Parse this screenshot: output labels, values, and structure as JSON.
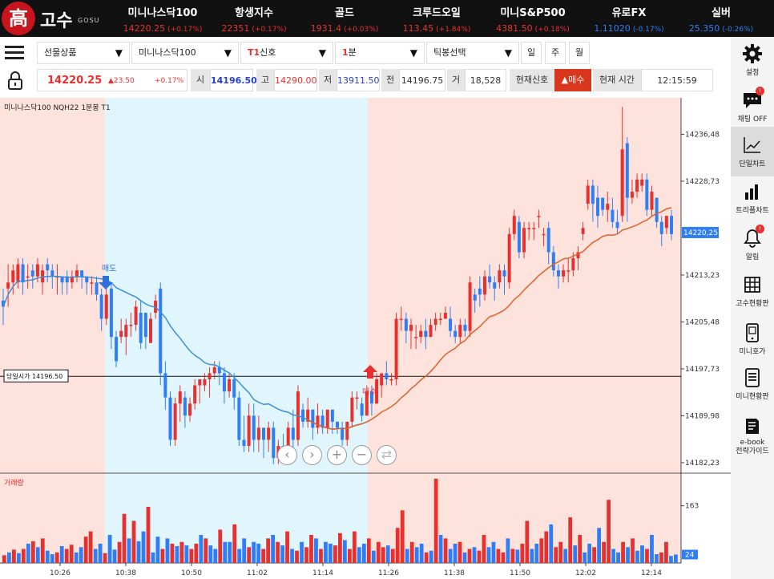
{
  "brand": {
    "logo_char": "高",
    "name": "고수",
    "sub": "GOSU"
  },
  "tickers": [
    {
      "name": "미니나스닥100",
      "value": "14220.25",
      "change": "(+0.17%)",
      "dir": "up"
    },
    {
      "name": "항생지수",
      "value": "22351",
      "change": "(+0.17%)",
      "dir": "up"
    },
    {
      "name": "골드",
      "value": "1931.4",
      "change": "(+0.03%)",
      "dir": "up"
    },
    {
      "name": "크루드오일",
      "value": "113.45",
      "change": "(+1.84%)",
      "dir": "up"
    },
    {
      "name": "미니S&P500",
      "value": "4381.50",
      "change": "(+0.18%)",
      "dir": "up"
    },
    {
      "name": "유로FX",
      "value": "1.11020",
      "change": "(-0.17%)",
      "dir": "down"
    },
    {
      "name": "실버",
      "value": "25.350",
      "change": "(-0.26%)",
      "dir": "down"
    }
  ],
  "toolbar": {
    "product_type": "선물상품",
    "product": "미니나스닥100",
    "signal_prefix": "T1",
    "signal": "신호",
    "interval_num": "1",
    "interval_unit": "분",
    "tick": "틱봉선택",
    "periods": [
      "일",
      "주",
      "월"
    ]
  },
  "quote": {
    "price": "14220.25",
    "change": "▲23.50",
    "pct": "+0.17%",
    "open_label": "시",
    "open": "14196.50",
    "high_label": "고",
    "high": "14290.00",
    "low_label": "저",
    "low": "13911.50",
    "prev_label": "전",
    "prev": "14196.75",
    "vol_label": "거",
    "volume": "18,528",
    "signal_label": "현재신호",
    "signal_value": "▲매수",
    "time_label": "현재 시간",
    "time": "12:15:59"
  },
  "chart_title": "미니나스닥100  NQH22  1분봉  T1",
  "volume_title": "거래량",
  "open_price_label": "당일시가 14196.50",
  "sell_label": "매도",
  "buy_label": "매수",
  "colors": {
    "up": "#e8312f",
    "down": "#2f7ef7",
    "ma_blue": "#3a8fd8",
    "ma_red": "#e0602a",
    "bg_pink": "#fde3dc",
    "bg_cyan": "#e1f5fd"
  },
  "sidebar": [
    {
      "icon": "gear-icon",
      "label": "설정"
    },
    {
      "icon": "chat-icon",
      "label": "채팅 OFF",
      "badge": "!"
    },
    {
      "icon": "line-chart-icon",
      "label": "단일차트",
      "active": true
    },
    {
      "icon": "bar-chart-icon",
      "label": "트리플차트"
    },
    {
      "icon": "bell-icon",
      "label": "알림",
      "badge": "!"
    },
    {
      "icon": "grid-icon",
      "label": "고수현황판"
    },
    {
      "icon": "phone-icon",
      "label": "미니호가"
    },
    {
      "icon": "list-icon",
      "label": "미니현황판"
    },
    {
      "icon": "book-icon",
      "label": "e-book\n전략가이드"
    }
  ],
  "chart_data": {
    "type": "candlestick",
    "y_ticks": [
      14236.48,
      14228.73,
      14213.23,
      14205.48,
      14197.73,
      14189.98,
      14182.23
    ],
    "ylim": [
      14180.5,
      14242.5
    ],
    "current_price": "14220.25",
    "open_line": 14196.5,
    "x_ticks": [
      "10:26",
      "10:38",
      "10:50",
      "11:02",
      "11:14",
      "11:26",
      "11:38",
      "11:50",
      "12:02",
      "12:14"
    ],
    "volume_ticks": [
      "163",
      "24"
    ],
    "volume_max": 240,
    "candles": [
      [
        14209,
        14208,
        14205,
        14211
      ],
      [
        14211,
        14212,
        14208,
        14215
      ],
      [
        14212,
        14214,
        14210,
        14215
      ],
      [
        14212,
        14215,
        14211,
        14216
      ],
      [
        14215,
        14212,
        14210,
        14216
      ],
      [
        14213,
        14213,
        14211,
        14215
      ],
      [
        14214,
        14213,
        14211,
        14215
      ],
      [
        14213,
        14215,
        14212,
        14216
      ],
      [
        14212,
        14214,
        14210,
        14215
      ],
      [
        14215,
        14214,
        14212,
        14216
      ],
      [
        14214,
        14213,
        14211,
        14215
      ],
      [
        14213,
        14213,
        14210,
        14215
      ],
      [
        14213,
        14212,
        14210,
        14213
      ],
      [
        14213,
        14212,
        14210,
        14214
      ],
      [
        14212,
        14213,
        14211,
        14214
      ],
      [
        14213,
        14214,
        14212,
        14215
      ],
      [
        14214,
        14213,
        14211,
        14214
      ],
      [
        14213,
        14212,
        14210,
        14213
      ],
      [
        14212,
        14212,
        14210,
        14213
      ],
      [
        14212,
        14210,
        14209,
        14213
      ],
      [
        14210,
        14206,
        14204,
        14211
      ],
      [
        14206,
        14210,
        14205,
        14211
      ],
      [
        14211,
        14203,
        14201,
        14212
      ],
      [
        14203,
        14199,
        14198,
        14204
      ],
      [
        14203,
        14204,
        14202,
        14206
      ],
      [
        14203,
        14205,
        14200,
        14206
      ],
      [
        14205,
        14205,
        14203,
        14207
      ],
      [
        14205,
        14208,
        14204,
        14209
      ],
      [
        14207,
        14202,
        14201,
        14209
      ],
      [
        14207,
        14203,
        14201,
        14207
      ],
      [
        14202,
        14206,
        14202,
        14207
      ],
      [
        14207,
        14209,
        14206,
        14210
      ],
      [
        14211,
        14197,
        14195,
        14212
      ],
      [
        14197,
        14193,
        14191,
        14199
      ],
      [
        14193,
        14186,
        14185,
        14194
      ],
      [
        14186,
        14192,
        14185,
        14193
      ],
      [
        14192,
        14194,
        14189,
        14195
      ],
      [
        14193,
        14190,
        14188,
        14194
      ],
      [
        14190,
        14192,
        14189,
        14193
      ],
      [
        14192,
        14195,
        14191,
        14196
      ],
      [
        14195,
        14196,
        14192,
        14196
      ],
      [
        14195,
        14196,
        14194,
        14197
      ],
      [
        14196,
        14197,
        14193,
        14198
      ],
      [
        14197,
        14198,
        14196,
        14199
      ],
      [
        14198,
        14197,
        14195,
        14199
      ],
      [
        14197,
        14194,
        14192,
        14198
      ],
      [
        14194,
        14196,
        14193,
        14197
      ],
      [
        14196,
        14193,
        14191,
        14197
      ],
      [
        14193,
        14186,
        14185,
        14194
      ],
      [
        14186,
        14185,
        14184,
        14190
      ],
      [
        14185,
        14190,
        14184,
        14192
      ],
      [
        14190,
        14186,
        14184,
        14192
      ],
      [
        14186,
        14188,
        14184,
        14190
      ],
      [
        14188,
        14186,
        14183,
        14188
      ],
      [
        14186,
        14188,
        14184,
        14189
      ],
      [
        14188,
        14183,
        14182,
        14189
      ],
      [
        14183,
        14185,
        14182,
        14186
      ],
      [
        14185,
        14184,
        14183,
        14187
      ],
      [
        14184,
        14188,
        14183,
        14189
      ],
      [
        14188,
        14186,
        14183,
        14191
      ],
      [
        14186,
        14194,
        14185,
        14195
      ],
      [
        14191,
        14189,
        14188,
        14192
      ],
      [
        14189,
        14191,
        14188,
        14193
      ],
      [
        14191,
        14188,
        14186,
        14191
      ],
      [
        14188,
        14190,
        14187,
        14192
      ],
      [
        14190,
        14188,
        14187,
        14191
      ],
      [
        14188,
        14191,
        14187,
        14191
      ],
      [
        14191,
        14189,
        14187,
        14191
      ],
      [
        14189,
        14188,
        14187,
        14189
      ],
      [
        14188,
        14186,
        14185,
        14189
      ],
      [
        14186,
        14189,
        14185,
        14189
      ],
      [
        14189,
        14193,
        14188,
        14194
      ],
      [
        14193,
        14193,
        14191,
        14194
      ],
      [
        14192,
        14190,
        14189,
        14193
      ],
      [
        14190,
        14194,
        14190,
        14195
      ],
      [
        14194,
        14192,
        14190,
        14195
      ],
      [
        14192,
        14196,
        14192,
        14197
      ],
      [
        14195,
        14197,
        14193,
        14197
      ],
      [
        14197,
        14196,
        14195,
        14199
      ],
      [
        14196,
        14196,
        14195,
        14197
      ],
      [
        14196,
        14206,
        14195,
        14207
      ],
      [
        14206,
        14206,
        14204,
        14208
      ],
      [
        14206,
        14204,
        14202,
        14207
      ],
      [
        14204,
        14205,
        14201,
        14206
      ],
      [
        14203,
        14203,
        14201,
        14205
      ],
      [
        14203,
        14204,
        14202,
        14205
      ],
      [
        14204,
        14203,
        14201,
        14206
      ],
      [
        14203,
        14205,
        14203,
        14206
      ],
      [
        14205,
        14206,
        14204,
        14207
      ],
      [
        14206,
        14206,
        14205,
        14207
      ],
      [
        14206,
        14207,
        14206,
        14208
      ],
      [
        14206,
        14204,
        14203,
        14208
      ],
      [
        14204,
        14203,
        14202,
        14205
      ],
      [
        14203,
        14205,
        14202,
        14206
      ],
      [
        14205,
        14204,
        14203,
        14206
      ],
      [
        14204,
        14212,
        14203,
        14213
      ],
      [
        14210,
        14209,
        14207,
        14211
      ],
      [
        14211,
        14210,
        14208,
        14213
      ],
      [
        14210,
        14213,
        14209,
        14214
      ],
      [
        14213,
        14212,
        14211,
        14215
      ],
      [
        14212,
        14211,
        14209,
        14213
      ],
      [
        14212,
        14214,
        14211,
        14215
      ],
      [
        14214,
        14213,
        14210,
        14215
      ],
      [
        14212,
        14220,
        14211,
        14221
      ],
      [
        14220,
        14223,
        14219,
        14224
      ],
      [
        14222,
        14217,
        14216,
        14223
      ],
      [
        14217,
        14221,
        14216,
        14222
      ],
      [
        14221,
        14221,
        14219,
        14222
      ],
      [
        14221,
        14221,
        14219,
        14222
      ],
      [
        14223,
        14223,
        14221,
        14224
      ],
      [
        14220,
        14220,
        14218,
        14221
      ],
      [
        14221,
        14217,
        14215,
        14222
      ],
      [
        14217,
        14214,
        14213,
        14218
      ],
      [
        14214,
        14213,
        14211,
        14215
      ],
      [
        14213,
        14214,
        14212,
        14215
      ],
      [
        14214,
        14214,
        14212,
        14216
      ],
      [
        14214,
        14216,
        14213,
        14217
      ],
      [
        14216,
        14217,
        14214,
        14218
      ],
      [
        14220,
        14221,
        14219,
        14222
      ],
      [
        14225,
        14228,
        14224,
        14229
      ],
      [
        14228,
        14225,
        14222,
        14229
      ],
      [
        14226,
        14223,
        14221,
        14228
      ],
      [
        14226,
        14224,
        14223,
        14226
      ],
      [
        14224,
        14225,
        14222,
        14227
      ],
      [
        14224,
        14222,
        14221,
        14226
      ],
      [
        14222,
        14221,
        14220,
        14224
      ],
      [
        14223,
        14234,
        14222,
        14241
      ],
      [
        14235,
        14226,
        14222,
        14236
      ],
      [
        14226,
        14227,
        14225,
        14229
      ],
      [
        14227,
        14229,
        14226,
        14230
      ],
      [
        14228,
        14229,
        14227,
        14230
      ],
      [
        14229,
        14224,
        14223,
        14230
      ],
      [
        14224,
        14227,
        14223,
        14228
      ],
      [
        14226,
        14222,
        14221,
        14226
      ],
      [
        14222,
        14220,
        14218,
        14223
      ],
      [
        14221,
        14223,
        14220,
        14223
      ],
      [
        14223,
        14220,
        14219,
        14224
      ]
    ],
    "volumes": [
      [
        22,
        "u"
      ],
      [
        30,
        "d"
      ],
      [
        38,
        "u"
      ],
      [
        28,
        "d"
      ],
      [
        40,
        "u"
      ],
      [
        55,
        "d"
      ],
      [
        62,
        "u"
      ],
      [
        45,
        "d"
      ],
      [
        70,
        "u"
      ],
      [
        35,
        "d"
      ],
      [
        25,
        "d"
      ],
      [
        30,
        "u"
      ],
      [
        48,
        "d"
      ],
      [
        40,
        "u"
      ],
      [
        52,
        "u"
      ],
      [
        30,
        "d"
      ],
      [
        45,
        "d"
      ],
      [
        75,
        "u"
      ],
      [
        90,
        "u"
      ],
      [
        40,
        "d"
      ],
      [
        55,
        "d"
      ],
      [
        28,
        "u"
      ],
      [
        80,
        "d"
      ],
      [
        38,
        "d"
      ],
      [
        60,
        "u"
      ],
      [
        140,
        "u"
      ],
      [
        70,
        "d"
      ],
      [
        120,
        "u"
      ],
      [
        62,
        "d"
      ],
      [
        90,
        "d"
      ],
      [
        160,
        "u"
      ],
      [
        30,
        "d"
      ],
      [
        75,
        "d"
      ],
      [
        40,
        "u"
      ],
      [
        70,
        "d"
      ],
      [
        55,
        "u"
      ],
      [
        48,
        "d"
      ],
      [
        60,
        "u"
      ],
      [
        50,
        "d"
      ],
      [
        40,
        "u"
      ],
      [
        55,
        "u"
      ],
      [
        80,
        "d"
      ],
      [
        70,
        "u"
      ],
      [
        50,
        "d"
      ],
      [
        40,
        "d"
      ],
      [
        95,
        "u"
      ],
      [
        60,
        "d"
      ],
      [
        60,
        "d"
      ],
      [
        110,
        "u"
      ],
      [
        40,
        "d"
      ],
      [
        70,
        "d"
      ],
      [
        45,
        "u"
      ],
      [
        60,
        "d"
      ],
      [
        55,
        "d"
      ],
      [
        40,
        "u"
      ],
      [
        70,
        "u"
      ],
      [
        80,
        "d"
      ],
      [
        60,
        "u"
      ],
      [
        50,
        "d"
      ],
      [
        90,
        "u"
      ],
      [
        40,
        "d"
      ],
      [
        35,
        "u"
      ],
      [
        60,
        "d"
      ],
      [
        45,
        "u"
      ],
      [
        80,
        "u"
      ],
      [
        70,
        "d"
      ],
      [
        40,
        "u"
      ],
      [
        60,
        "d"
      ],
      [
        55,
        "d"
      ],
      [
        50,
        "u"
      ],
      [
        85,
        "u"
      ],
      [
        65,
        "d"
      ],
      [
        40,
        "u"
      ],
      [
        90,
        "u"
      ],
      [
        45,
        "d"
      ],
      [
        55,
        "d"
      ],
      [
        70,
        "u"
      ],
      [
        35,
        "d"
      ],
      [
        60,
        "u"
      ],
      [
        45,
        "u"
      ],
      [
        50,
        "d"
      ],
      [
        40,
        "u"
      ],
      [
        100,
        "u"
      ],
      [
        150,
        "u"
      ],
      [
        40,
        "d"
      ],
      [
        60,
        "u"
      ],
      [
        45,
        "d"
      ],
      [
        55,
        "d"
      ],
      [
        30,
        "u"
      ],
      [
        35,
        "d"
      ],
      [
        240,
        "u"
      ],
      [
        80,
        "d"
      ],
      [
        70,
        "u"
      ],
      [
        40,
        "d"
      ],
      [
        55,
        "d"
      ],
      [
        60,
        "u"
      ],
      [
        30,
        "d"
      ],
      [
        40,
        "u"
      ],
      [
        45,
        "d"
      ],
      [
        35,
        "u"
      ],
      [
        80,
        "u"
      ],
      [
        45,
        "d"
      ],
      [
        60,
        "d"
      ],
      [
        40,
        "u"
      ],
      [
        30,
        "u"
      ],
      [
        70,
        "d"
      ],
      [
        40,
        "u"
      ],
      [
        38,
        "d"
      ],
      [
        55,
        "u"
      ],
      [
        120,
        "u"
      ],
      [
        40,
        "d"
      ],
      [
        55,
        "d"
      ],
      [
        70,
        "u"
      ],
      [
        90,
        "u"
      ],
      [
        110,
        "d"
      ],
      [
        45,
        "u"
      ],
      [
        60,
        "u"
      ],
      [
        40,
        "d"
      ],
      [
        130,
        "u"
      ],
      [
        50,
        "d"
      ],
      [
        80,
        "u"
      ],
      [
        30,
        "d"
      ],
      [
        55,
        "d"
      ],
      [
        45,
        "u"
      ],
      [
        100,
        "d"
      ],
      [
        60,
        "u"
      ],
      [
        180,
        "u"
      ],
      [
        40,
        "d"
      ],
      [
        30,
        "d"
      ],
      [
        60,
        "u"
      ],
      [
        45,
        "d"
      ],
      [
        70,
        "u"
      ],
      [
        35,
        "d"
      ],
      [
        50,
        "d"
      ],
      [
        40,
        "u"
      ],
      [
        80,
        "d"
      ],
      [
        25,
        "d"
      ],
      [
        30,
        "u"
      ],
      [
        60,
        "u"
      ],
      [
        20,
        "d"
      ],
      [
        24,
        "d"
      ]
    ]
  }
}
